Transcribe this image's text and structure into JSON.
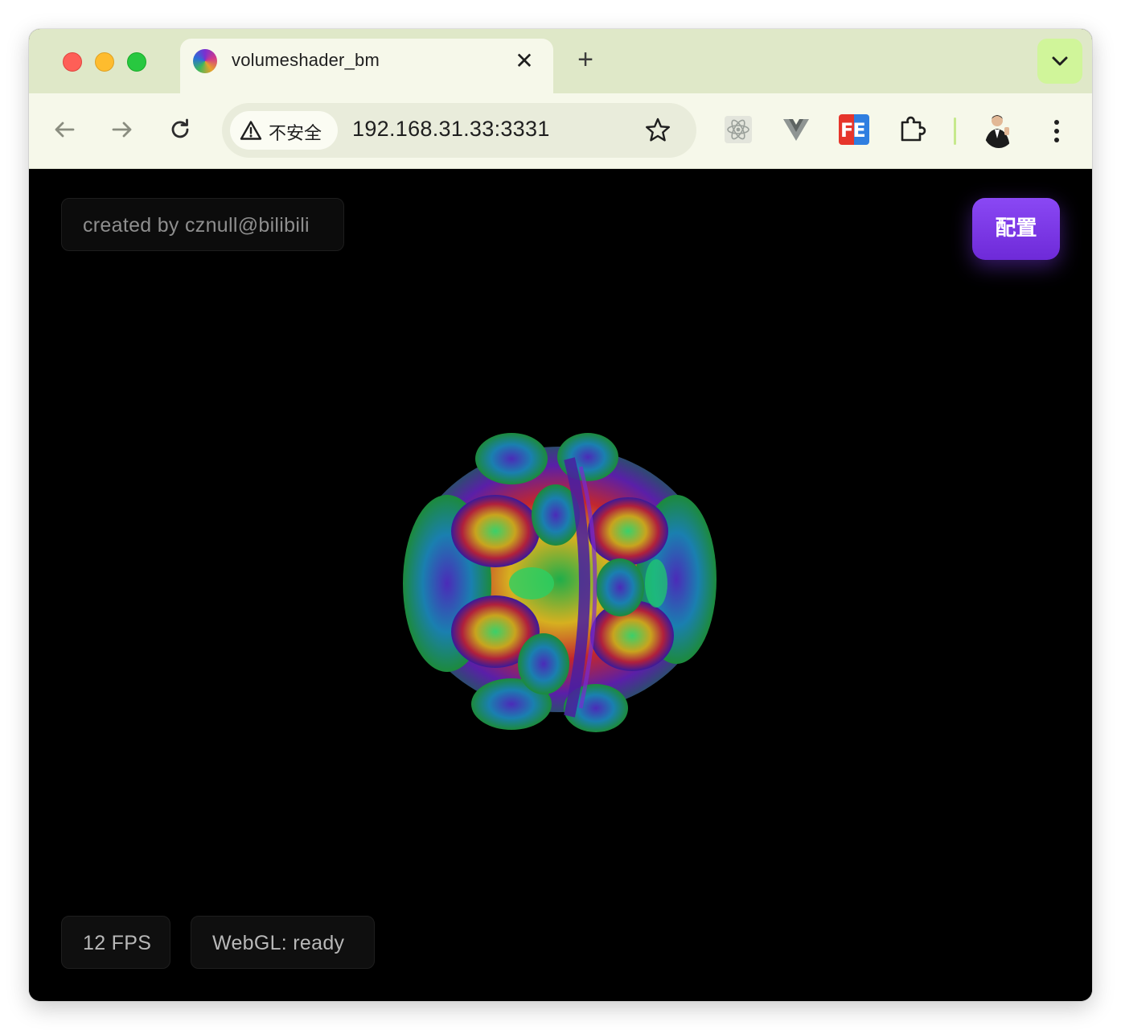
{
  "browser": {
    "tab": {
      "title": "volumeshader_bm",
      "close_glyph": "✕"
    },
    "new_tab_glyph": "+",
    "omnibox": {
      "security_label": "不安全",
      "url": "192.168.31.33:3331"
    },
    "icons": {
      "back": "arrow-left-icon",
      "forward": "arrow-right-icon",
      "reload": "reload-icon",
      "warning": "warning-triangle-icon",
      "bookmark": "star-icon",
      "ext_react": "react-devtools-icon",
      "ext_vue": "vue-devtools-icon",
      "ext_fe": "fehelper-icon",
      "extensions": "puzzle-icon",
      "menu": "kebab-menu-icon"
    },
    "ext_fe_label": "FE",
    "colors": {
      "tab_strip": "#dfe8c8",
      "toolbar": "#f6f8ea",
      "tab_search": "#d0f59a"
    }
  },
  "page": {
    "credit": "created by cznull@bilibili",
    "config_button": "配置",
    "fps": "12 FPS",
    "webgl_status": "WebGL: ready",
    "accent": "#7c3aed"
  }
}
